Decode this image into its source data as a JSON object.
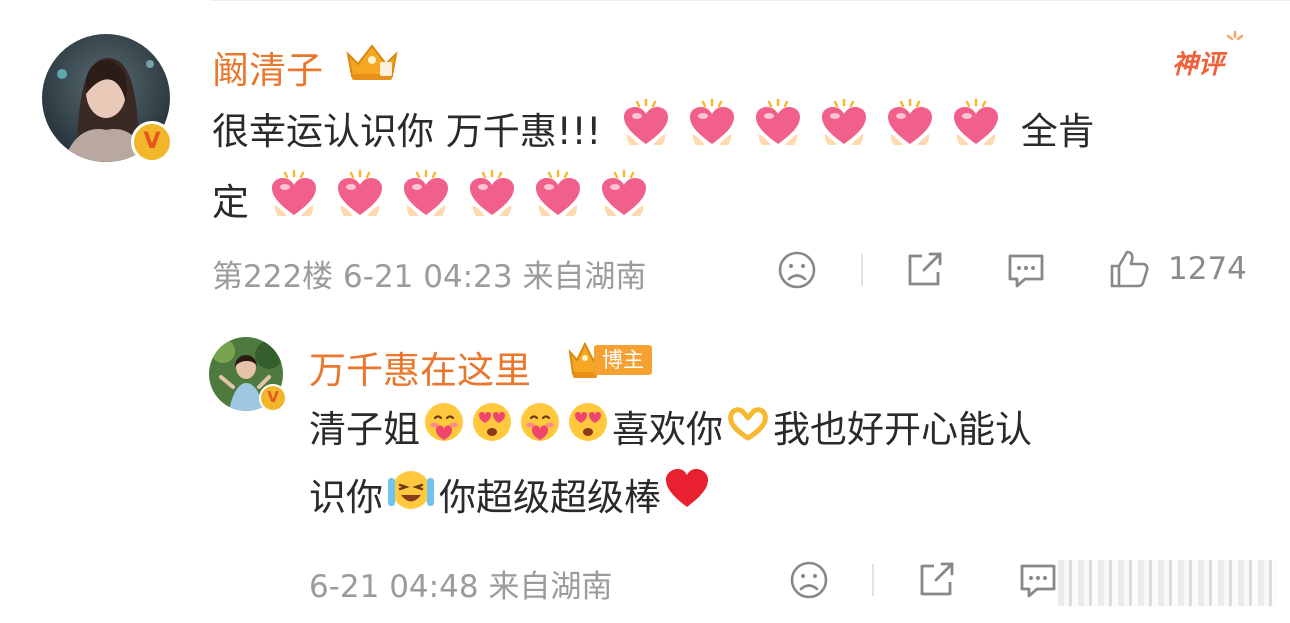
{
  "comment": {
    "username": "阚清子",
    "badge": "神评",
    "text_part1": "很幸运认识你 万千惠!!!",
    "text_part2": "全肯",
    "text_part3": "定",
    "floor": "第222楼",
    "date": "6-21 04:23",
    "location": "来自湖南",
    "like_count": "1274",
    "verified_mark": "V",
    "hearts_line1_count": 6,
    "hearts_line2_count": 6,
    "icons": [
      "dislike-icon",
      "share-icon",
      "comment-icon",
      "like-icon"
    ]
  },
  "reply": {
    "username": "万千惠在这里",
    "role_badge": "博主",
    "text_a": "清子姐",
    "text_b": "喜欢你",
    "text_c": "我也好开心能认",
    "text_d": "识你",
    "text_e": "你超级超级棒",
    "date": "6-21 04:48",
    "location": "来自湖南",
    "verified_mark": "V",
    "icons": [
      "dislike-icon",
      "share-icon",
      "comment-icon"
    ]
  },
  "colors": {
    "username": "#e9772e",
    "meta": "#9b9b9b",
    "text": "#2a2a2a",
    "heart": "#f0608a",
    "badge": "#f6a232"
  }
}
